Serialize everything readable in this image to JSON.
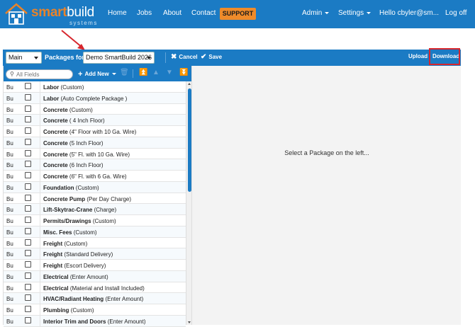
{
  "header": {
    "brand_main": "smart",
    "brand_accent": "build",
    "brand_tagline": "systems",
    "nav": [
      {
        "label": "Home"
      },
      {
        "label": "Jobs"
      },
      {
        "label": "About"
      },
      {
        "label": "Contact"
      }
    ],
    "support_label": "SUPPORT",
    "admin_label": "Admin",
    "settings_label": "Settings",
    "user_label": "Hello cbyler@sm...",
    "logout_label": "Log off"
  },
  "toolbar": {
    "view_select": "Main",
    "packages_for_label": "Packages for",
    "package_select": "Demo SmartBuild 2026",
    "cancel_label": "Cancel",
    "save_label": "Save",
    "upload_label": "Upload",
    "download_label": "Download"
  },
  "left": {
    "search_placeholder": "All Fields",
    "add_new_label": "Add New",
    "rows": [
      {
        "code": "Bu",
        "name": "Labor",
        "detail": "(Custom)"
      },
      {
        "code": "Bu",
        "name": "Labor",
        "detail": "(Auto Complete Package )"
      },
      {
        "code": "Bu",
        "name": "Concrete",
        "detail": "(Custom)"
      },
      {
        "code": "Bu",
        "name": "Concrete",
        "detail": "( 4 Inch Floor)"
      },
      {
        "code": "Bu",
        "name": "Concrete",
        "detail": "(4\" Floor with 10 Ga. Wire)"
      },
      {
        "code": "Bu",
        "name": "Concrete",
        "detail": "(5 Inch Floor)"
      },
      {
        "code": "Bu",
        "name": "Concrete",
        "detail": "(5\" Fl. with 10 Ga. Wire)"
      },
      {
        "code": "Bu",
        "name": "Concrete",
        "detail": "(6 Inch Floor)"
      },
      {
        "code": "Bu",
        "name": "Concrete",
        "detail": "(6\" Fl. with 6 Ga. Wire)"
      },
      {
        "code": "Bu",
        "name": "Foundation",
        "detail": "(Custom)"
      },
      {
        "code": "Bu",
        "name": "Concrete Pump",
        "detail": "(Per Day Charge)"
      },
      {
        "code": "Bu",
        "name": "Lift-Skytrac-Crane",
        "detail": "(Charge)"
      },
      {
        "code": "Bu",
        "name": "Permits/Drawings",
        "detail": "(Custom)"
      },
      {
        "code": "Bu",
        "name": "Misc. Fees",
        "detail": "(Custom)"
      },
      {
        "code": "Bu",
        "name": "Freight",
        "detail": "(Custom)"
      },
      {
        "code": "Bu",
        "name": "Freight",
        "detail": "(Standard Delivery)"
      },
      {
        "code": "Bu",
        "name": "Freight",
        "detail": "(Escort Delivery)"
      },
      {
        "code": "Bu",
        "name": "Electrical",
        "detail": "(Enter Amount)"
      },
      {
        "code": "Bu",
        "name": "Electrical",
        "detail": "(Material and Install Included)"
      },
      {
        "code": "Bu",
        "name": "HVAC/Radiant Heating",
        "detail": "(Enter Amount)"
      },
      {
        "code": "Bu",
        "name": "Plumbing",
        "detail": "(Custom)"
      },
      {
        "code": "Bu",
        "name": "Interior Trim and Doors",
        "detail": "(Enter Amount)"
      }
    ]
  },
  "right": {
    "placeholder": "Select a Package on the left..."
  },
  "colors": {
    "primary": "#1b7bc4",
    "accent": "#ef8b2a",
    "highlight": "#d7262d"
  }
}
